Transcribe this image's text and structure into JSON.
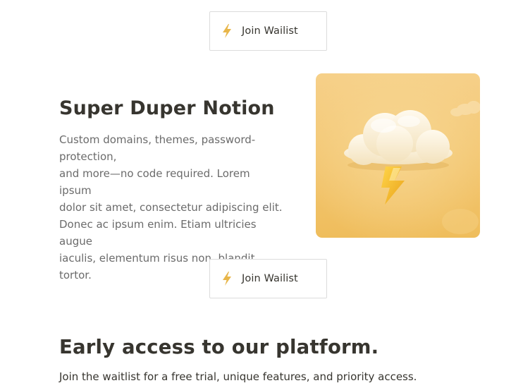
{
  "top_cta": {
    "label": "Join Wailist",
    "icon": "lightning-icon"
  },
  "feature": {
    "title": "Super Duper Notion",
    "description_lines": [
      "Custom domains, themes, password-",
      "protection,",
      "and more—no code required. Lorem ipsum",
      "dolor sit amet, consectetur adipiscing elit.",
      "Donec ac ipsum enim. Etiam ultricies augue",
      "iaculis, elementum risus non, blandit tortor."
    ],
    "illustration": "storm-cloud-lightning-illustration"
  },
  "mid_cta": {
    "label": "Join Wailist",
    "icon": "lightning-icon"
  },
  "early_access": {
    "title": "Early access to our platform.",
    "subtitle": "Join the waitlist for a free trial, unique features, and priority access."
  },
  "colors": {
    "accent": "#e8b64a",
    "text": "#37352f",
    "muted": "#6b6b6b",
    "border": "#dcdcdc",
    "art_background": "#f4c76e"
  }
}
